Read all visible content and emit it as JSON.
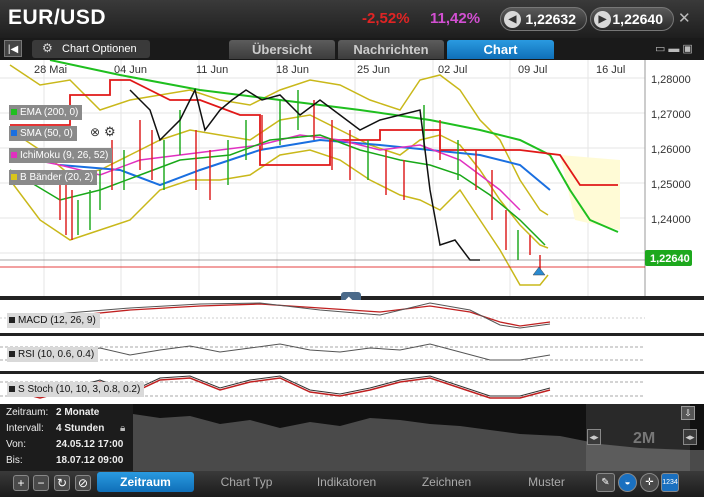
{
  "header": {
    "pair": "EUR/USD",
    "change_pct": "-2,52%",
    "change_pct2": "11,42%",
    "bid": "1,22632",
    "ask": "1,22640",
    "close_icon": "close-icon"
  },
  "toolbar": {
    "chart_options_label": "Chart Optionen",
    "tabs": [
      "Übersicht",
      "Nachrichten",
      "Chart"
    ],
    "active_tab": "Chart"
  },
  "chart": {
    "x_ticks": [
      "28 Mai",
      "04 Jun",
      "11 Jun",
      "18 Jun",
      "25 Jun",
      "02 Jul",
      "09 Jul",
      "16 Jul"
    ],
    "y_ticks": [
      "1,28000",
      "1,27000",
      "1,26000",
      "1,25000",
      "1,24000"
    ],
    "current_price": "1,22640",
    "legend": [
      {
        "label": "EMA (200, 0)",
        "color": "#1fbf1f"
      },
      {
        "label": "SMA (50, 0)",
        "color": "#1a6fe0"
      },
      {
        "label": "IchiMoku (9, 26, 52)",
        "color": "#e030c0"
      },
      {
        "label": "B Bänder (20, 2)",
        "color": "#d8c51a"
      }
    ],
    "indicators": [
      {
        "label": "MACD (12, 26, 9)"
      },
      {
        "label": "RSI (10, 0.6, 0.4)"
      },
      {
        "label": "S Stoch (10, 10, 3, 0.8, 0.2)"
      }
    ]
  },
  "chart_data": {
    "type": "line",
    "title": "EUR/USD",
    "x": [
      "28 Mai",
      "04 Jun",
      "11 Jun",
      "18 Jun",
      "25 Jun",
      "02 Jul",
      "09 Jul"
    ],
    "ylim": [
      1.225,
      1.28
    ],
    "series": [
      {
        "name": "EUR/USD",
        "values": [
          1.245,
          1.252,
          1.262,
          1.265,
          1.257,
          1.262,
          1.2264
        ]
      },
      {
        "name": "EMA (200, 0)",
        "values": [
          1.279,
          1.276,
          1.271,
          1.268,
          1.265,
          1.262,
          1.257
        ]
      },
      {
        "name": "SMA (50, 0)",
        "values": [
          1.252,
          1.253,
          1.256,
          1.26,
          1.261,
          1.259,
          1.251
        ]
      }
    ]
  },
  "navigator": {
    "zeitraum_label": "Zeitraum:",
    "zeitraum_value": "2 Monate",
    "intervall_label": "Intervall:",
    "intervall_value": "4 Stunden",
    "von_label": "Von:",
    "von_value": "24.05.12 17:00",
    "bis_label": "Bis:",
    "bis_value": "18.07.12 09:00",
    "range_label": "2M"
  },
  "bottom": {
    "tabs": [
      "Zeitraum",
      "Chart Typ",
      "Indikatoren",
      "Zeichnen",
      "Muster"
    ],
    "active_tab": "Zeitraum"
  }
}
